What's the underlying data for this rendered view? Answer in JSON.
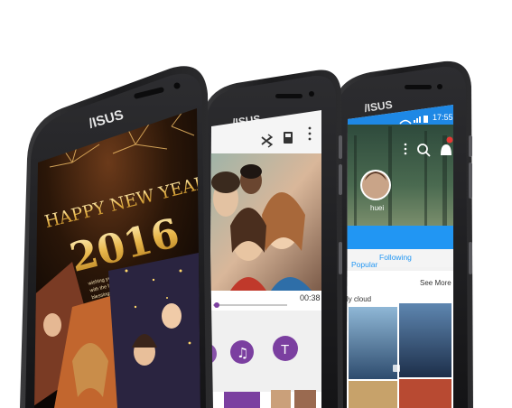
{
  "phones": [
    {
      "brand": "/ISUS",
      "card": {
        "line1": "HAPPY NEW YEAR",
        "year": "2016",
        "message": [
          "wishing you a 'Happy New Year'",
          "with the hope that you will have many",
          "blessings in the year to come"
        ]
      }
    },
    {
      "brand": "/ISUS",
      "toolbar_icons": [
        "shuffle-icon",
        "save-icon",
        "more-vert-icon"
      ],
      "video_time": "00:38",
      "tool_buttons": [
        {
          "icon": "music-note-icon",
          "glyph": "♫",
          "color": "#7b3fa0"
        },
        {
          "icon": "text-tool-icon",
          "glyph": "T",
          "color": "#7b3fa0"
        }
      ]
    },
    {
      "brand": "/ISUS",
      "status_time": "17:55",
      "profile_name": "huei",
      "tabs": [
        "Popular",
        "Following"
      ],
      "section_title": "ly cloud",
      "see_more": "See More",
      "colors": {
        "statusbar": "#1e88e5",
        "tabbar": "#2196f3"
      }
    }
  ]
}
